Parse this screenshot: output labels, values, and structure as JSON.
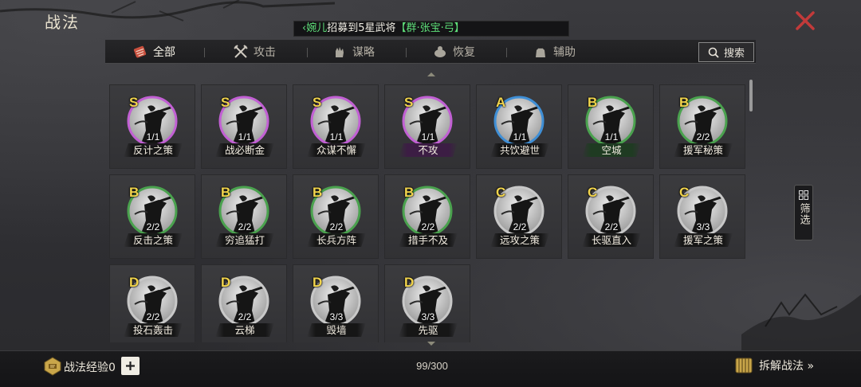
{
  "header": {
    "title": "战法",
    "notice": {
      "name": "‹婉儿",
      "text": "招募到5星武将",
      "general": "【群·张宝·弓】"
    }
  },
  "tabs": [
    {
      "label": "全部",
      "icon": "all-tactics-icon",
      "active": true
    },
    {
      "label": "攻击",
      "icon": "crossed-swords-icon",
      "active": false
    },
    {
      "label": "谋略",
      "icon": "strategy-hand-icon",
      "active": false
    },
    {
      "label": "恢复",
      "icon": "recovery-icon",
      "active": false
    },
    {
      "label": "辅助",
      "icon": "support-bag-icon",
      "active": false
    }
  ],
  "search": {
    "label": "搜索"
  },
  "filter": {
    "label": "筛选"
  },
  "tactics": [
    {
      "grade": "S",
      "uses": "1/1",
      "name": "反计之策",
      "ring": "#c260d4",
      "band": ""
    },
    {
      "grade": "S",
      "uses": "1/1",
      "name": "战必断金",
      "ring": "#c260d4",
      "band": ""
    },
    {
      "grade": "S",
      "uses": "1/1",
      "name": "众谋不懈",
      "ring": "#c260d4",
      "band": ""
    },
    {
      "grade": "S",
      "uses": "1/1",
      "name": "不攻",
      "ring": "#c260d4",
      "band": "p"
    },
    {
      "grade": "A",
      "uses": "1/1",
      "name": "共饮避世",
      "ring": "#3f8fd6",
      "band": ""
    },
    {
      "grade": "B",
      "uses": "1/1",
      "name": "空城",
      "ring": "#4aa24e",
      "band": "g"
    },
    {
      "grade": "B",
      "uses": "2/2",
      "name": "援军秘策",
      "ring": "#4aa24e",
      "band": ""
    },
    {
      "grade": "B",
      "uses": "2/2",
      "name": "反击之策",
      "ring": "#4aa24e",
      "band": ""
    },
    {
      "grade": "B",
      "uses": "2/2",
      "name": "穷追猛打",
      "ring": "#4aa24e",
      "band": ""
    },
    {
      "grade": "B",
      "uses": "2/2",
      "name": "长兵方阵",
      "ring": "#4aa24e",
      "band": ""
    },
    {
      "grade": "B",
      "uses": "2/2",
      "name": "措手不及",
      "ring": "#4aa24e",
      "band": ""
    },
    {
      "grade": "C",
      "uses": "2/2",
      "name": "远攻之策",
      "ring": "#c8c8c8",
      "band": ""
    },
    {
      "grade": "C",
      "uses": "2/2",
      "name": "长驱直入",
      "ring": "#c8c8c8",
      "band": ""
    },
    {
      "grade": "C",
      "uses": "3/3",
      "name": "援军之策",
      "ring": "#c8c8c8",
      "band": ""
    },
    {
      "grade": "D",
      "uses": "2/2",
      "name": "投石轰击",
      "ring": "#c8c8c8",
      "band": ""
    },
    {
      "grade": "D",
      "uses": "2/2",
      "name": "云梯",
      "ring": "#c8c8c8",
      "band": ""
    },
    {
      "grade": "D",
      "uses": "3/3",
      "name": "毁墙",
      "ring": "#c8c8c8",
      "band": ""
    },
    {
      "grade": "D",
      "uses": "3/3",
      "name": "先驱",
      "ring": "#c8c8c8",
      "band": ""
    }
  ],
  "footer": {
    "exp_label": "战法经验0",
    "count": "99/300",
    "dismantle_label": "拆解战法 »"
  }
}
